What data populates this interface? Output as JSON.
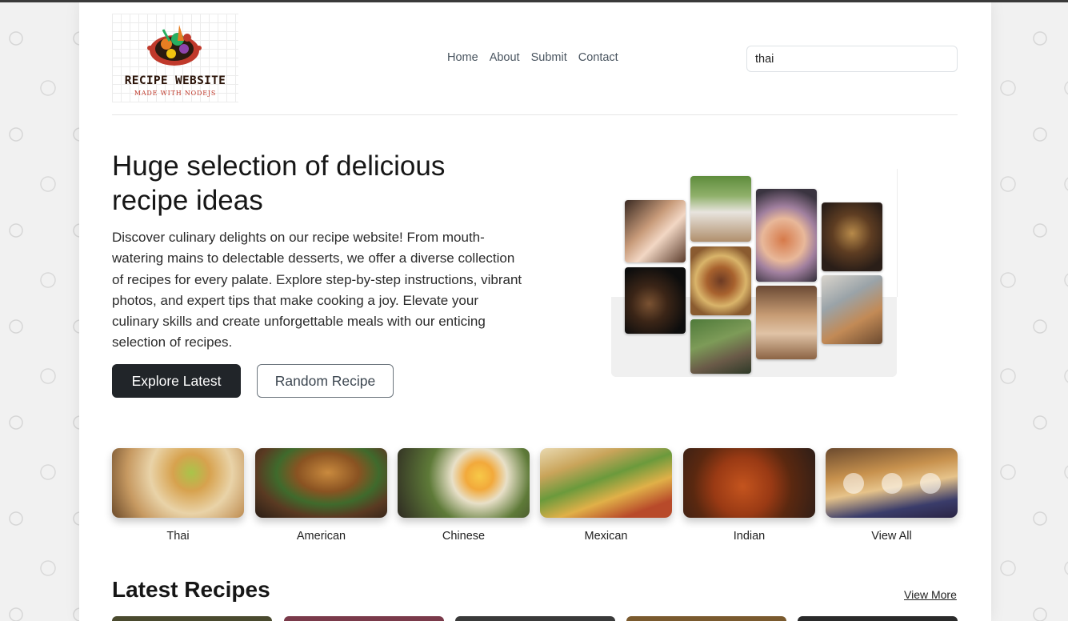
{
  "brand": {
    "title": "RECIPE WEBSITE",
    "subtitle": "MADE WITH NODEJS",
    "icon": "cooking-pot-logo"
  },
  "nav": {
    "items": [
      {
        "label": "Home"
      },
      {
        "label": "About"
      },
      {
        "label": "Submit"
      },
      {
        "label": "Contact"
      }
    ]
  },
  "search": {
    "value": "thai",
    "placeholder": ""
  },
  "hero": {
    "title": "Huge selection of delicious recipe ideas",
    "text": "Discover culinary delights on our recipe website! From mouth-watering mains to delectable desserts, we offer a diverse collection of recipes for every palate. Explore step-by-step instructions, vibrant photos, and expert tips that make cooking a joy. Elevate your culinary skills and create unforgettable meals with our enticing selection of recipes.",
    "primary_button": "Explore Latest",
    "secondary_button": "Random Recipe"
  },
  "categories": [
    {
      "label": "Thai"
    },
    {
      "label": "American"
    },
    {
      "label": "Chinese"
    },
    {
      "label": "Mexican"
    },
    {
      "label": "Indian"
    },
    {
      "label": "View All"
    }
  ],
  "latest": {
    "title": "Latest Recipes",
    "view_more": "View More"
  },
  "colors": {
    "primary_button": "#212529",
    "accent_red": "#c0392b",
    "text": "#161616"
  }
}
